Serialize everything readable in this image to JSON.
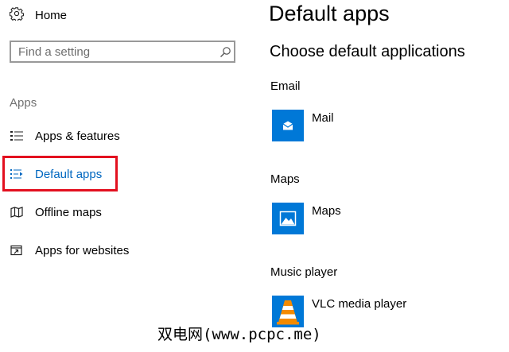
{
  "sidebar": {
    "home": {
      "label": "Home",
      "icon": "gear-icon"
    },
    "search": {
      "placeholder": "Find a setting",
      "value": "",
      "icon": "search-icon"
    },
    "section_label": "Apps",
    "items": [
      {
        "label": "Apps & features",
        "icon": "list-icon",
        "active": false
      },
      {
        "label": "Default apps",
        "icon": "default-apps-list-icon",
        "active": true
      },
      {
        "label": "Offline maps",
        "icon": "map-icon",
        "active": false
      },
      {
        "label": "Apps for websites",
        "icon": "open-in-app-icon",
        "active": false
      }
    ]
  },
  "main": {
    "title": "Default apps",
    "subtitle": "Choose default applications",
    "categories": [
      {
        "label": "Email",
        "app": {
          "name": "Mail",
          "icon": "mail-icon",
          "tile_color": "#0078d7"
        }
      },
      {
        "label": "Maps",
        "app": {
          "name": "Maps",
          "icon": "maps-icon",
          "tile_color": "#0078d7"
        }
      },
      {
        "label": "Music player",
        "app": {
          "name": "VLC media player",
          "icon": "vlc-cone-icon",
          "tile_color": "#0078d7"
        }
      }
    ]
  },
  "watermark": "双电网(www.pcpc.me)",
  "colors": {
    "accent": "#0067c0",
    "tile": "#0078d7",
    "highlight": "#e3101f"
  }
}
